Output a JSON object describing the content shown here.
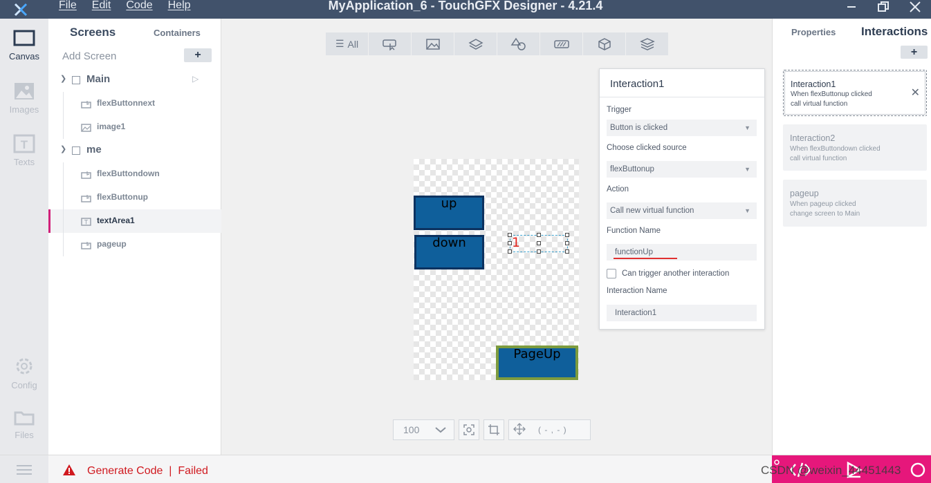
{
  "titlebar": {
    "logo": "touchgfx-logo-icon",
    "menu": [
      "File",
      "Edit",
      "Code",
      "Help"
    ],
    "title": "MyApplication_6 - TouchGFX Designer - 4.21.4"
  },
  "leftnav": {
    "items": [
      {
        "label": "Canvas",
        "icon": "canvas-icon",
        "active": true
      },
      {
        "label": "Images",
        "icon": "image-icon",
        "active": false
      },
      {
        "label": "Texts",
        "icon": "text-icon",
        "active": false
      },
      {
        "label": "Config",
        "icon": "gear-icon",
        "active": false
      },
      {
        "label": "Files",
        "icon": "folder-icon",
        "active": false
      }
    ]
  },
  "screens_panel": {
    "tab_screens": "Screens",
    "tab_containers": "Containers",
    "add_screen": "Add Screen",
    "add_symbol": "+",
    "screens": [
      {
        "name": "Main",
        "widgets": [
          {
            "name": "flexButtonnext",
            "type": "button"
          },
          {
            "name": "image1",
            "type": "image"
          }
        ]
      },
      {
        "name": "me",
        "widgets": [
          {
            "name": "flexButtondown",
            "type": "button"
          },
          {
            "name": "flexButtonup",
            "type": "button"
          },
          {
            "name": "textArea1",
            "type": "text",
            "selected": true
          },
          {
            "name": "pageup",
            "type": "button"
          }
        ]
      }
    ]
  },
  "canvas": {
    "filter_all": "All",
    "stage": {
      "btn_up": "up",
      "btn_down": "down",
      "btn_pageup": "PageUp",
      "text_area": "1"
    },
    "zoom": "100",
    "coords": "( - , - )"
  },
  "popup": {
    "title": "Interaction1",
    "trigger_label": "Trigger",
    "trigger_value": "Button is clicked",
    "source_label": "Choose clicked source",
    "source_value": "flexButtonup",
    "action_label": "Action",
    "action_value": "Call new virtual function",
    "function_label": "Function Name",
    "function_value": "functionUp",
    "can_trigger_label": "Can trigger another interaction",
    "interaction_name_label": "Interaction Name",
    "interaction_name_value": "Interaction1"
  },
  "right_panel": {
    "tab_properties": "Properties",
    "tab_interactions": "Interactions",
    "add_symbol": "+",
    "interactions": [
      {
        "title": "Interaction1",
        "line1": "When flexButtonup clicked",
        "line2": "call virtual function",
        "selected": true
      },
      {
        "title": "Interaction2",
        "line1": "When flexButtondown clicked",
        "line2": "call virtual function",
        "selected": false
      },
      {
        "title": "pageup",
        "line1": "When pageup clicked",
        "line2": "change screen to Main",
        "selected": false
      }
    ]
  },
  "bottombar": {
    "status": "Generate Code  |  Failed",
    "watermark": "CSDN @weixin_44451443"
  },
  "colors": {
    "titlebar": "#41526b",
    "accent_pink": "#e6177b",
    "error_red": "#d0191f",
    "button_fill": "#0f5f9b"
  }
}
